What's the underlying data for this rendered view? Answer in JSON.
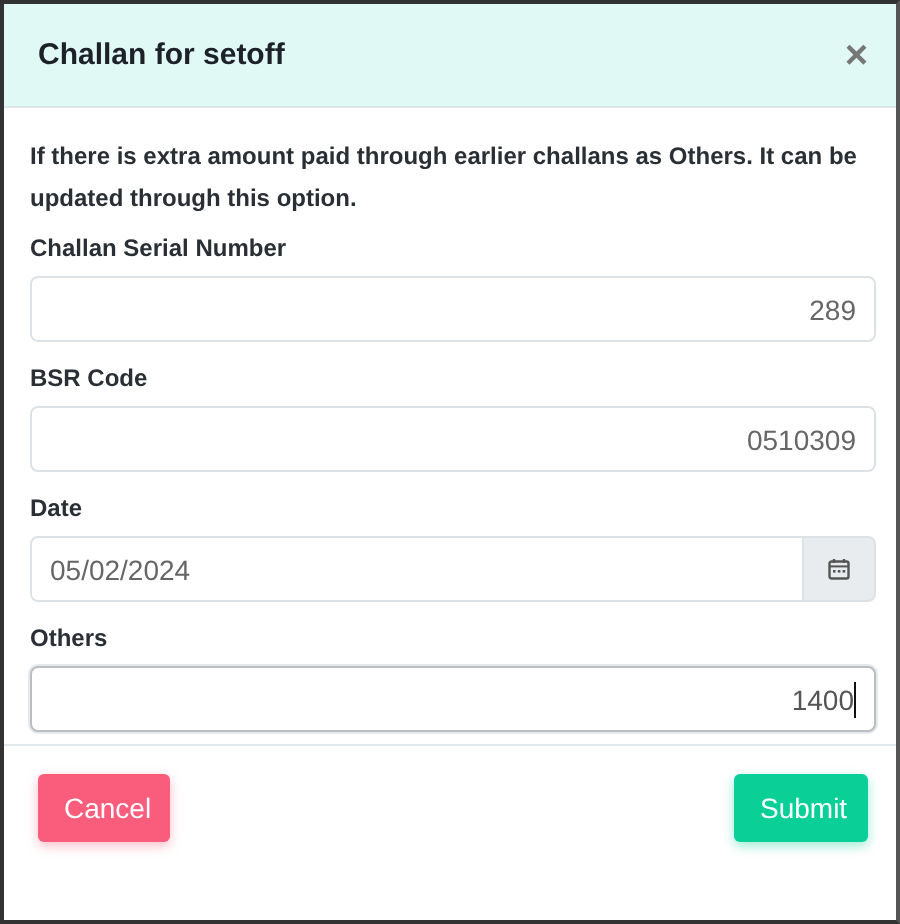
{
  "dialog": {
    "title": "Challan for setoff",
    "close": "×"
  },
  "description": "If there is extra amount paid through earlier challans as Others. It can be updated through this option.",
  "fields": [
    {
      "label": "Challan Serial Number",
      "kind": "number",
      "value": "289",
      "focused": false
    },
    {
      "label": "BSR Code",
      "kind": "number",
      "value": "0510309",
      "focused": false
    },
    {
      "label": "Date",
      "kind": "date",
      "value": "05/02/2024",
      "focused": false
    },
    {
      "label": "Others",
      "kind": "number",
      "value": "1400",
      "focused": true
    }
  ],
  "buttons": [
    {
      "label": "Cancel",
      "kind": "cancel"
    },
    {
      "label": "Submit",
      "kind": "submit"
    }
  ]
}
